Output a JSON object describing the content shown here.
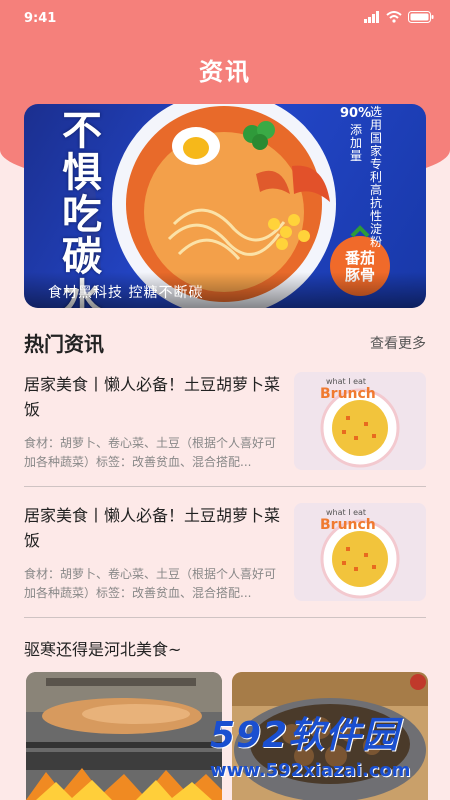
{
  "status_bar": {
    "time": "9:41"
  },
  "header": {
    "title": "资讯"
  },
  "banner": {
    "caption": "食材黑科技 控糖不断碳",
    "headline": "不惧吃碳水",
    "badge_percent": "90%",
    "badge_text": "添加量",
    "side_text": "选用国家专利高抗性淀粉",
    "corner_tag": "番茄豚骨",
    "colors": {
      "bg": "#2346c8",
      "accent": "#ff8c2a"
    }
  },
  "hot_news": {
    "title": "热门资讯",
    "more_label": "查看更多",
    "items": [
      {
        "title": "居家美食丨懒人必备！土豆胡萝卜菜饭",
        "desc": "食材：胡萝卜、卷心菜、土豆（根据个人喜好可加各种蔬菜）标签：改善贫血、混合搭配..."
      },
      {
        "title": "居家美食丨懒人必备！土豆胡萝卜菜饭",
        "desc": "食材：胡萝卜、卷心菜、土豆（根据个人喜好可加各种蔬菜）标签：改善贫血、混合搭配..."
      }
    ],
    "thumb_caption_top": "what I eat",
    "thumb_caption_word": "Brunch"
  },
  "section2": {
    "title": "驱寒还得是河北美食~"
  },
  "watermark": {
    "brand": "592软件园",
    "url": "www.592xiazai.com"
  },
  "theme": {
    "primary": "#f5807b",
    "page_bg": "#fde9e8"
  }
}
